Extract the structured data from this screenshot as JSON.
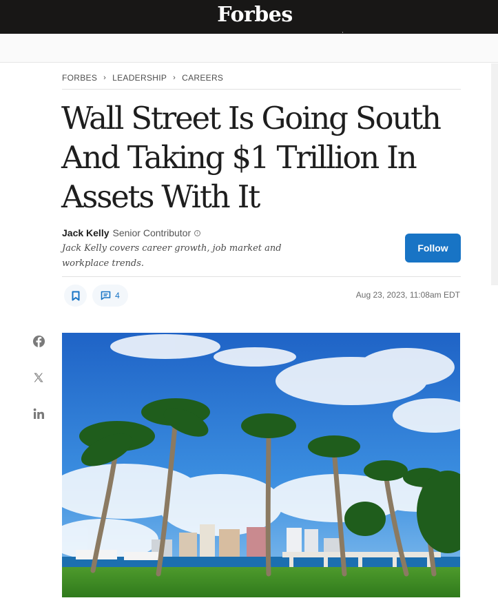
{
  "brand": {
    "logo_text": "Forbes"
  },
  "breadcrumb": {
    "items": [
      "FORBES",
      "LEADERSHIP",
      "CAREERS"
    ],
    "separator": "›"
  },
  "article": {
    "headline": "Wall Street Is Going South And Taking $1 Trillion In Assets With It",
    "author": {
      "name": "Jack Kelly",
      "role": "Senior Contributor",
      "bio": "Jack Kelly covers career growth, job market and workplace trends.",
      "follow_label": "Follow"
    },
    "comment_count": "4",
    "dateline": "Aug 23, 2023, 11:08am EDT"
  },
  "share": {
    "icons": [
      "facebook-icon",
      "x-icon",
      "linkedin-icon"
    ]
  },
  "hero": {
    "image_subject": "palm-trees-waterfront-skyline"
  },
  "colors": {
    "topbar": "#181716",
    "accent": "#1874c5",
    "headline": "#1e1e1e"
  }
}
